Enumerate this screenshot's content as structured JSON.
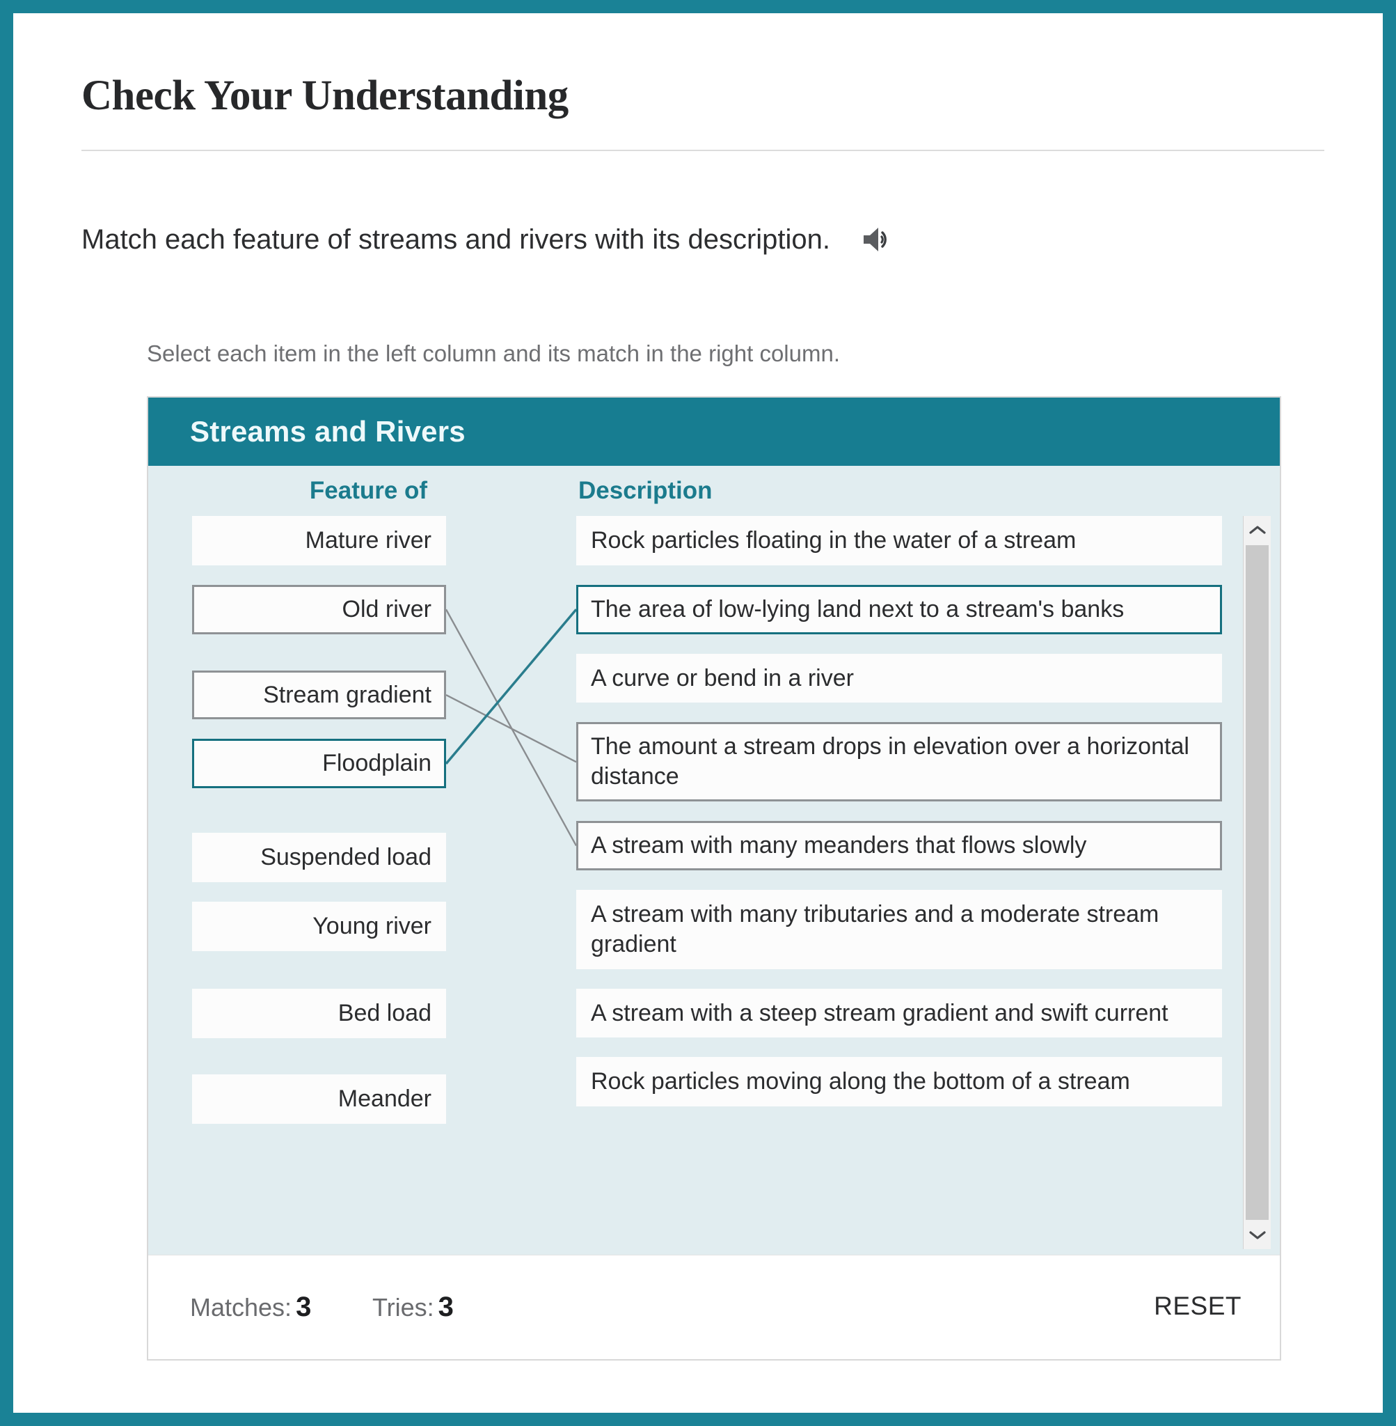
{
  "theme": {
    "frame_teal": "#1a8296",
    "header_teal": "#177d91",
    "accent_teal": "#1b7b8d",
    "selected_border": "#15707f",
    "panel_bg": "#e1edf0",
    "option_bg": "#fcfcfc",
    "neutral_border": "#8e9295"
  },
  "heading": "Check Your Understanding",
  "prompt": {
    "text": "Match each feature of streams and rivers with its description.",
    "audio_icon": "speaker-icon"
  },
  "sub_instruction": "Select each item in the left column and its match in the right column.",
  "card": {
    "title": "Streams and Rivers",
    "columns": {
      "left_header": "Feature of",
      "right_header": "Description"
    },
    "left_items": [
      {
        "label": "Mature river",
        "state": "plain"
      },
      {
        "label": "Old river",
        "state": "bordered"
      },
      {
        "label": "Stream gradient",
        "state": "bordered"
      },
      {
        "label": "Floodplain",
        "state": "selected"
      },
      {
        "label": "Suspended load",
        "state": "plain"
      },
      {
        "label": "Young river",
        "state": "plain"
      },
      {
        "label": "Bed load",
        "state": "plain"
      },
      {
        "label": "Meander",
        "state": "plain"
      }
    ],
    "right_items": [
      {
        "label": "Rock particles floating in the water of a stream",
        "state": "plain"
      },
      {
        "label": "The area of low-lying land next to a stream's banks",
        "state": "selected"
      },
      {
        "label": "A curve or bend in a river",
        "state": "plain"
      },
      {
        "label": "The amount a stream drops in elevation over a horizontal distance",
        "state": "bordered"
      },
      {
        "label": "A stream with many meanders that flows slowly",
        "state": "bordered"
      },
      {
        "label": "A stream with many tributaries and a moderate stream gradient",
        "state": "plain"
      },
      {
        "label": "A stream with a steep stream gradient and swift current",
        "state": "plain"
      },
      {
        "label": "Rock particles moving along the bottom of a stream",
        "state": "plain"
      }
    ],
    "connections": [
      {
        "from": "Old river",
        "to": "A stream with many meanders that flows slowly",
        "color": "#8a8d90"
      },
      {
        "from": "Stream gradient",
        "to": "The amount a stream drops in elevation over a horizontal distance",
        "color": "#8a8d90"
      },
      {
        "from": "Floodplain",
        "to": "The area of low-lying land next to a stream's banks",
        "color": "#2a7d8d"
      }
    ],
    "scrollbar": {
      "up_icon": "chevron-up-icon",
      "down_icon": "chevron-down-icon"
    },
    "footer": {
      "matches_label": "Matches:",
      "matches_value": "3",
      "tries_label": "Tries:",
      "tries_value": "3",
      "reset_label": "RESET"
    }
  }
}
